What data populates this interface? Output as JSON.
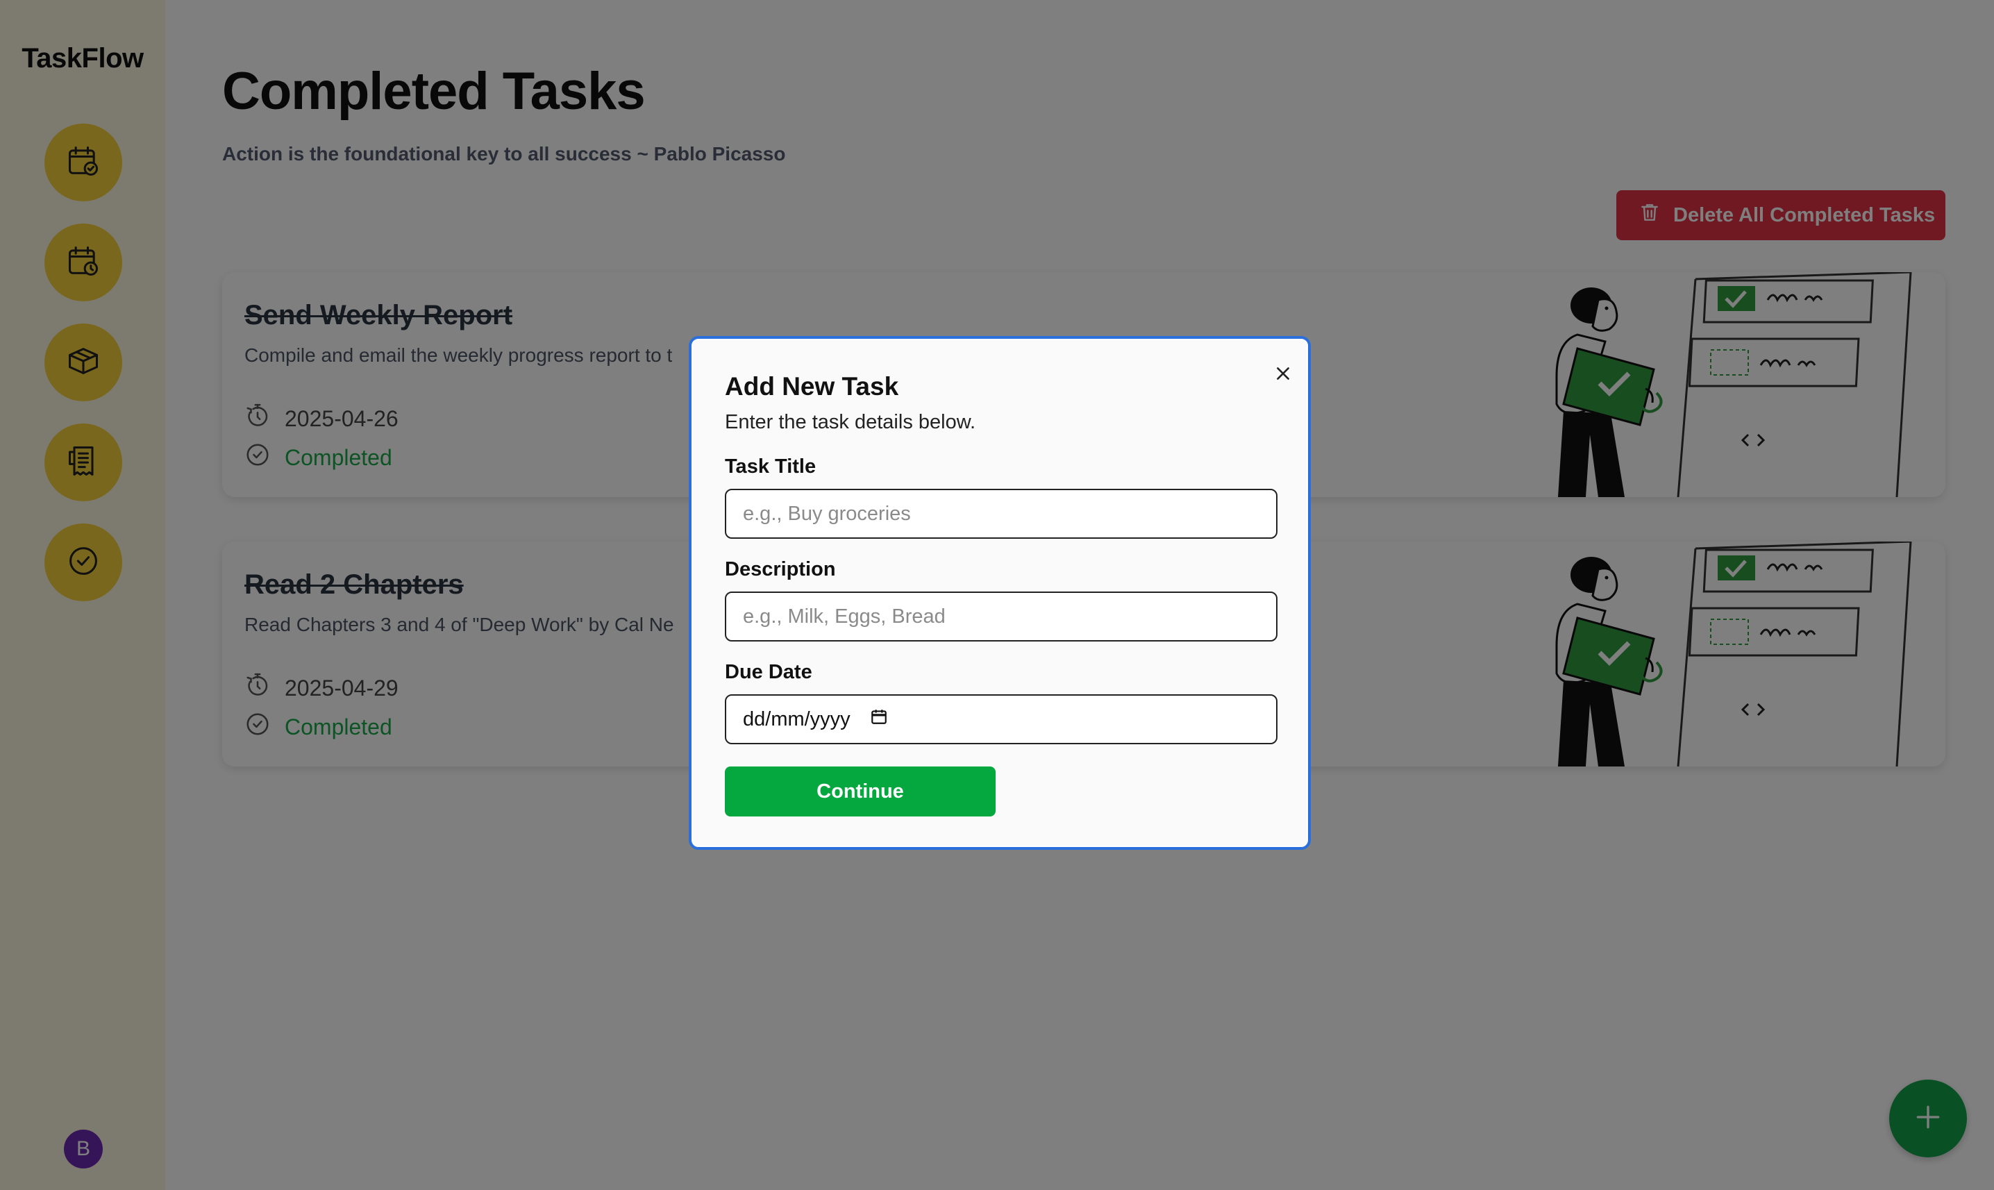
{
  "app": {
    "brand": "TaskFlow",
    "avatar_initial": "B"
  },
  "sidebar": {
    "items": [
      {
        "name": "calendar-check-icon"
      },
      {
        "name": "calendar-clock-icon"
      },
      {
        "name": "package-icon"
      },
      {
        "name": "receipt-icon"
      },
      {
        "name": "check-circle-icon"
      }
    ]
  },
  "page": {
    "title": "Completed Tasks",
    "quote": "Action is the foundational key to all success ~ Pablo Picasso",
    "delete_all_label": "Delete All Completed Tasks"
  },
  "tasks": [
    {
      "title": "Send Weekly Report",
      "description": "Compile and email the weekly progress report to t",
      "date": "2025-04-26",
      "status": "Completed"
    },
    {
      "title": "Read 2 Chapters",
      "description": "Read Chapters 3 and 4 of \"Deep Work\" by Cal Ne",
      "date": "2025-04-29",
      "status": "Completed"
    }
  ],
  "modal": {
    "title": "Add New Task",
    "subtitle": "Enter the task details below.",
    "task_title_label": "Task Title",
    "task_title_placeholder": "e.g., Buy groceries",
    "description_label": "Description",
    "description_placeholder": "e.g., Milk, Eggs, Bread",
    "due_date_label": "Due Date",
    "due_date_placeholder": "dd/mm/yyyy",
    "continue_label": "Continue"
  },
  "colors": {
    "sidebar_bg": "#fbf5de",
    "nav_button": "#f3cf3b",
    "danger": "#e03244",
    "success": "#1aa84a",
    "fab": "#13a34a",
    "modal_border": "#2a6fdb",
    "avatar": "#6a2bb0"
  }
}
